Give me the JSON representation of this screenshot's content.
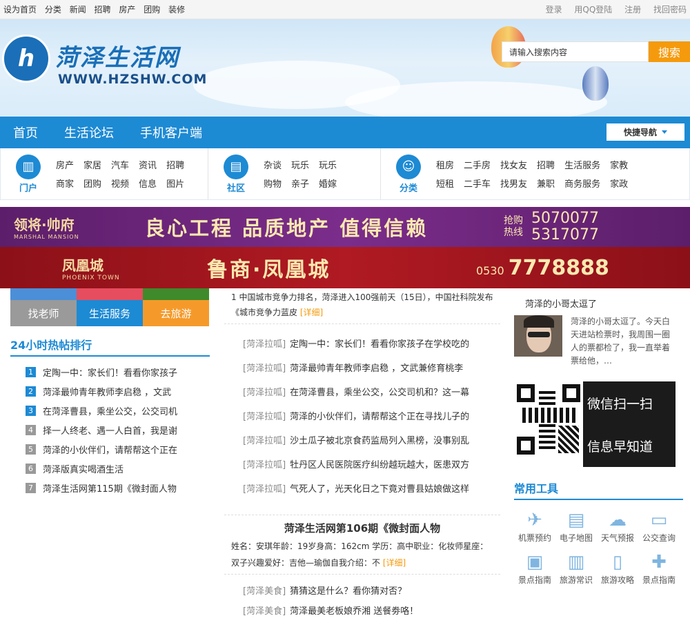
{
  "topbar": {
    "left": [
      "设为首页",
      "分类",
      "新闻",
      "招聘",
      "房产",
      "团购",
      "装修"
    ],
    "right": [
      "登录",
      "用QQ登陆",
      "注册",
      "找回密码"
    ]
  },
  "header": {
    "logo_text": "菏泽生活网",
    "logo_url": "WWW.HZSHW.COM",
    "search_placeholder": "请输入搜索内容",
    "search_button": "搜索"
  },
  "nav": {
    "items": [
      "首页",
      "生活论坛",
      "手机客户端"
    ],
    "quick": "快捷导航"
  },
  "categories": [
    {
      "label": "门户",
      "icon": "building-icon",
      "links": [
        "房产",
        "家居",
        "汽车",
        "资讯",
        "招聘",
        "商家",
        "团购",
        "视频",
        "信息",
        "图片"
      ]
    },
    {
      "label": "社区",
      "icon": "book-icon",
      "links": [
        "杂谈",
        "玩乐",
        "玩乐",
        "购物",
        "亲子",
        "婚嫁"
      ]
    },
    {
      "label": "分类",
      "icon": "people-icon",
      "links": [
        "租房",
        "二手房",
        "找女友",
        "招聘",
        "生活服务",
        "家教",
        "短租",
        "二手车",
        "找男友",
        "兼职",
        "商务服务",
        "家政"
      ]
    }
  ],
  "banner1": {
    "brand": "领将·帅府",
    "brand_en": "MARSHAL MANSION",
    "slogan": "良心工程 品质地产 值得信赖",
    "hotline_label": "抢购热线",
    "phone1": "5070077",
    "phone2": "5317077"
  },
  "banner2": {
    "brand": "凤凰城",
    "brand_en": "PHOENIX TOWN",
    "slogan": "鲁商·凤凰城",
    "phone_prefix": "0530",
    "phone": "7778888"
  },
  "left": {
    "buttons": [
      "找老师",
      "生活服务",
      "去旅游"
    ],
    "rank_title": "24小时热帖排行",
    "rank": [
      "定陶一中：家长们！看看你家孩子",
      "菏泽最帅青年教师李启稳 ，文武",
      "在菏泽曹县，乘坐公交，公交司机",
      "择一人终老、遇一人白首，我是谢",
      "菏泽的小伙伴们，请帮帮这个正在",
      "菏泽版真实喝酒生活",
      "菏泽生活网第115期《微封面人物"
    ]
  },
  "mid": {
    "top_text": "1 中国城市竞争力排名，菏泽进入100强前天（15日），中国社科院发布《城市竞争力蓝皮",
    "more": "[详细]",
    "news": [
      {
        "tag": "[菏泽拉呱]",
        "text": "定陶一中：家长们！看看你家孩子在学校吃的"
      },
      {
        "tag": "[菏泽拉呱]",
        "text": "菏泽最帅青年教师李启稳 ，文武兼修育桃李"
      },
      {
        "tag": "[菏泽拉呱]",
        "text": "在菏泽曹县，乘坐公交，公交司机和？这一幕"
      },
      {
        "tag": "[菏泽拉呱]",
        "text": "菏泽的小伙伴们，请帮帮这个正在寻找儿子的"
      },
      {
        "tag": "[菏泽拉呱]",
        "text": "沙土瓜子被北京食药监局列入黑榜，没事别乱"
      },
      {
        "tag": "[菏泽拉呱]",
        "text": "牡丹区人民医院医疗纠纷越玩越大，医患双方"
      },
      {
        "tag": "[菏泽拉呱]",
        "text": "气死人了，光天化日之下竟对曹县姑娘做这样"
      }
    ],
    "feature_title": "菏泽生活网第106期《微封面人物",
    "feature_desc": "姓名：安琪年龄：19岁身高：162cm 学历：高中职业：化妆师星座：双子兴趣爱好：吉他—瑜伽自我介绍：不",
    "bottom": [
      {
        "tag": "[菏泽美食]",
        "text": "猜猜这是什么？看你猜对否？"
      },
      {
        "tag": "[菏泽美食]",
        "text": "菏泽最美老板娘乔湘 送餐劵咯！"
      }
    ]
  },
  "right": {
    "profile_title": "菏泽的小哥太逗了",
    "profile_desc": "菏泽的小哥太逗了。今天白天进站检票时，我周围一圈人的票都检了，我一直举着票给他，…",
    "qr_text": [
      "微信扫一扫",
      "信息早知道"
    ],
    "tools_title": "常用工具",
    "tools": [
      {
        "label": "机票预约",
        "icon": "plane-icon",
        "glyph": "✈"
      },
      {
        "label": "电子地图",
        "icon": "map-icon",
        "glyph": "▤"
      },
      {
        "label": "天气预报",
        "icon": "weather-icon",
        "glyph": "☁"
      },
      {
        "label": "公交查询",
        "icon": "bus-icon",
        "glyph": "▭"
      },
      {
        "label": "景点指南",
        "icon": "train-icon",
        "glyph": "▣"
      },
      {
        "label": "旅游常识",
        "icon": "books-icon",
        "glyph": "▥"
      },
      {
        "label": "旅游攻略",
        "icon": "guidebook-icon",
        "glyph": "▯"
      },
      {
        "label": "景点指南",
        "icon": "signpost-icon",
        "glyph": "✚"
      }
    ]
  }
}
